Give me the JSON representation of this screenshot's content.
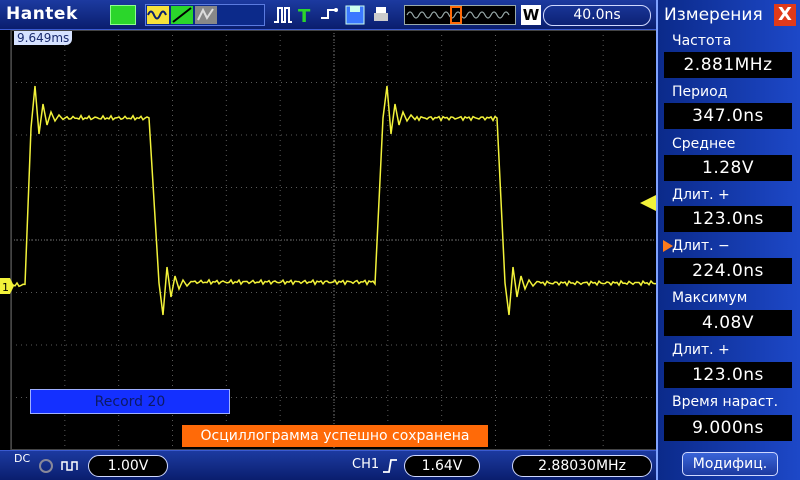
{
  "topbar": {
    "brand": "Hantek",
    "time_per_div": "40.0ns",
    "w_label": "W"
  },
  "screen": {
    "timebase_marker": "9.649ms",
    "ch1_marker": "1",
    "record": "Record 20",
    "status_message": "Осциллограмма успешно сохранена"
  },
  "bottombar": {
    "coupling": "DC",
    "volts_per_div": "1.00V",
    "trigger_source": "CH1",
    "trigger_level": "1.64V",
    "frequency": "2.88030MHz"
  },
  "panel": {
    "title": "Измерения",
    "close": "X",
    "measurements": [
      {
        "label": "Частота",
        "value": "2.881MHz"
      },
      {
        "label": "Период",
        "value": "347.0ns"
      },
      {
        "label": "Среднее",
        "value": "1.28V"
      },
      {
        "label": "Длит. +",
        "value": "123.0ns"
      },
      {
        "label": "Длит. −",
        "value": "224.0ns"
      },
      {
        "label": "Максимум",
        "value": "4.08V"
      },
      {
        "label": "Длит. +",
        "value": "123.0ns"
      },
      {
        "label": "Время нараст.",
        "value": "9.000ns"
      }
    ],
    "modify_button": "Модифиц."
  },
  "colors": {
    "trace": "#f2f23a",
    "grid": "#5a5a5a",
    "accent": "#ff6a08",
    "panel_blue": "#1d48c8"
  }
}
